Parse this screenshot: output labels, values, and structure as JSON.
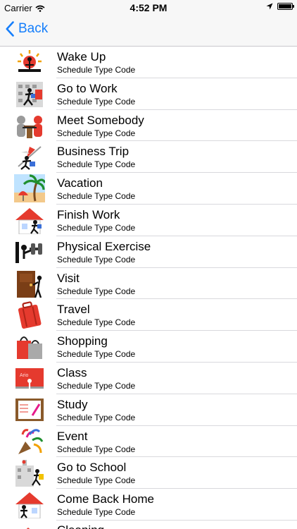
{
  "status_bar": {
    "carrier": "Carrier",
    "time": "4:52 PM",
    "battery_level": 1.0
  },
  "nav": {
    "back_label": "Back",
    "accent_color": "#157efb"
  },
  "schedule_types": {
    "items": [
      {
        "title": "Wake Up",
        "subtitle": "Schedule Type Code",
        "icon": "sunrise-icon"
      },
      {
        "title": "Go to Work",
        "subtitle": "Schedule Type Code",
        "icon": "office-building-icon"
      },
      {
        "title": "Meet Somebody",
        "subtitle": "Schedule Type Code",
        "icon": "meeting-people-icon"
      },
      {
        "title": "Business Trip",
        "subtitle": "Schedule Type Code",
        "icon": "airplane-icon"
      },
      {
        "title": "Vacation",
        "subtitle": "Schedule Type Code",
        "icon": "beach-palm-icon"
      },
      {
        "title": "Finish Work",
        "subtitle": "Schedule Type Code",
        "icon": "house-walk-icon"
      },
      {
        "title": "Physical Exercise",
        "subtitle": "Schedule Type Code",
        "icon": "dumbbell-icon"
      },
      {
        "title": "Visit",
        "subtitle": "Schedule Type Code",
        "icon": "door-knock-icon"
      },
      {
        "title": "Travel",
        "subtitle": "Schedule Type Code",
        "icon": "suitcase-icon"
      },
      {
        "title": "Shopping",
        "subtitle": "Schedule Type Code",
        "icon": "shopping-bags-icon"
      },
      {
        "title": "Class",
        "subtitle": "Schedule Type Code",
        "icon": "blackboard-icon"
      },
      {
        "title": "Study",
        "subtitle": "Schedule Type Code",
        "icon": "notebook-pencil-icon"
      },
      {
        "title": "Event",
        "subtitle": "Schedule Type Code",
        "icon": "party-confetti-icon"
      },
      {
        "title": "Go to School",
        "subtitle": "Schedule Type Code",
        "icon": "school-building-icon"
      },
      {
        "title": "Come Back Home",
        "subtitle": "Schedule Type Code",
        "icon": "house-return-icon"
      },
      {
        "title": "Cleaning",
        "subtitle": "",
        "icon": "cleaning-icon"
      }
    ]
  }
}
